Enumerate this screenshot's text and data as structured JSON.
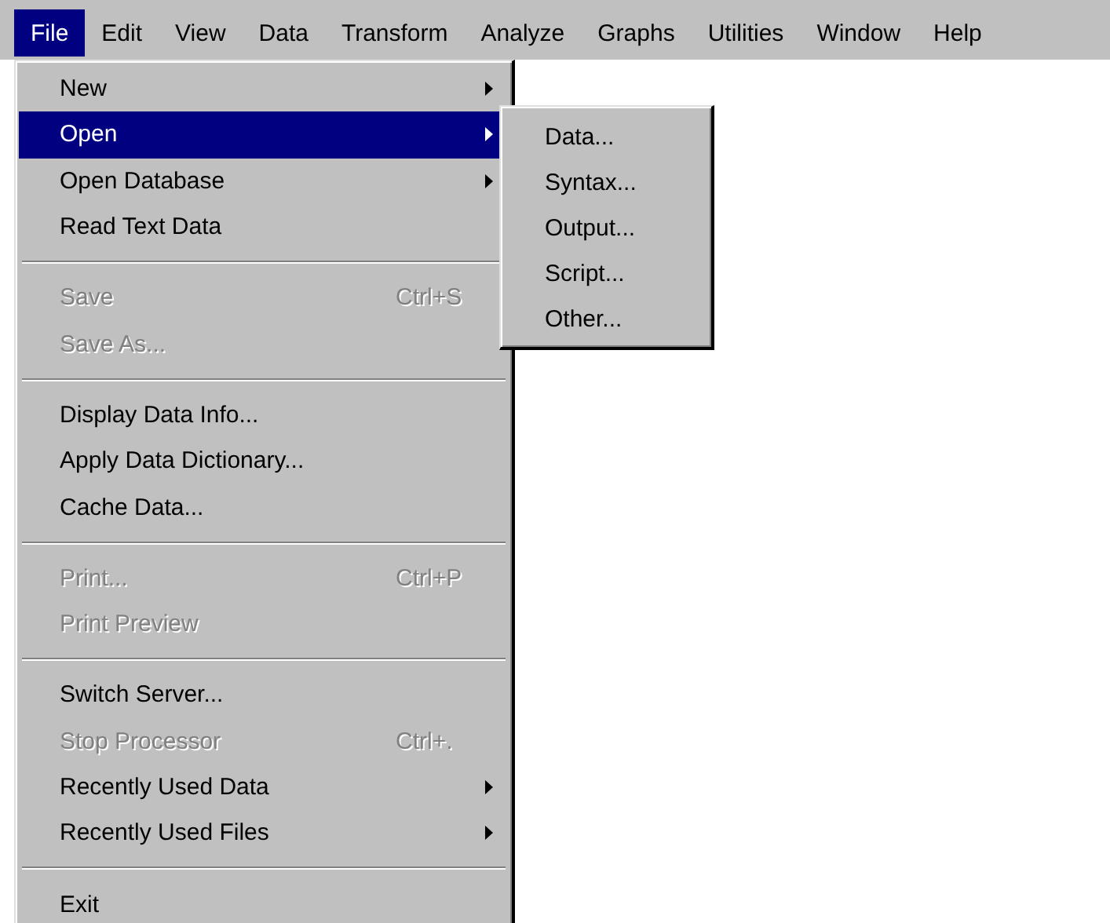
{
  "menu_bar": [
    {
      "label": "File",
      "selected": true
    },
    {
      "label": "Edit",
      "selected": false
    },
    {
      "label": "View",
      "selected": false
    },
    {
      "label": "Data",
      "selected": false
    },
    {
      "label": "Transform",
      "selected": false
    },
    {
      "label": "Analyze",
      "selected": false
    },
    {
      "label": "Graphs",
      "selected": false
    },
    {
      "label": "Utilities",
      "selected": false
    },
    {
      "label": "Window",
      "selected": false
    },
    {
      "label": "Help",
      "selected": false
    }
  ],
  "file_menu": [
    {
      "kind": "item",
      "label": "New",
      "disabled": false,
      "has_submenu": true,
      "selected": false
    },
    {
      "kind": "item",
      "label": "Open",
      "disabled": false,
      "has_submenu": true,
      "selected": true
    },
    {
      "kind": "item",
      "label": "Open Database",
      "disabled": false,
      "has_submenu": true,
      "selected": false
    },
    {
      "kind": "item",
      "label": "Read Text Data",
      "disabled": false,
      "has_submenu": false,
      "selected": false
    },
    {
      "kind": "separator"
    },
    {
      "kind": "item",
      "label": "Save",
      "shortcut": "Ctrl+S",
      "disabled": true,
      "has_submenu": false,
      "selected": false
    },
    {
      "kind": "item",
      "label": "Save As...",
      "disabled": true,
      "has_submenu": false,
      "selected": false
    },
    {
      "kind": "separator"
    },
    {
      "kind": "item",
      "label": "Display Data Info...",
      "disabled": false,
      "has_submenu": false,
      "selected": false
    },
    {
      "kind": "item",
      "label": "Apply Data Dictionary...",
      "disabled": false,
      "has_submenu": false,
      "selected": false
    },
    {
      "kind": "item",
      "label": "Cache Data...",
      "disabled": false,
      "has_submenu": false,
      "selected": false
    },
    {
      "kind": "separator"
    },
    {
      "kind": "item",
      "label": "Print...",
      "shortcut": "Ctrl+P",
      "disabled": true,
      "has_submenu": false,
      "selected": false
    },
    {
      "kind": "item",
      "label": "Print Preview",
      "disabled": true,
      "has_submenu": false,
      "selected": false
    },
    {
      "kind": "separator"
    },
    {
      "kind": "item",
      "label": "Switch Server...",
      "disabled": false,
      "has_submenu": false,
      "selected": false
    },
    {
      "kind": "item",
      "label": "Stop Processor",
      "shortcut": "Ctrl+.",
      "disabled": true,
      "has_submenu": false,
      "selected": false
    },
    {
      "kind": "item",
      "label": "Recently Used Data",
      "disabled": false,
      "has_submenu": true,
      "selected": false
    },
    {
      "kind": "item",
      "label": "Recently Used Files",
      "disabled": false,
      "has_submenu": true,
      "selected": false
    },
    {
      "kind": "separator"
    },
    {
      "kind": "item",
      "label": "Exit",
      "disabled": false,
      "has_submenu": false,
      "selected": false
    }
  ],
  "open_submenu": [
    {
      "label": "Data..."
    },
    {
      "label": "Syntax..."
    },
    {
      "label": "Output..."
    },
    {
      "label": "Script..."
    },
    {
      "label": "Other..."
    }
  ]
}
